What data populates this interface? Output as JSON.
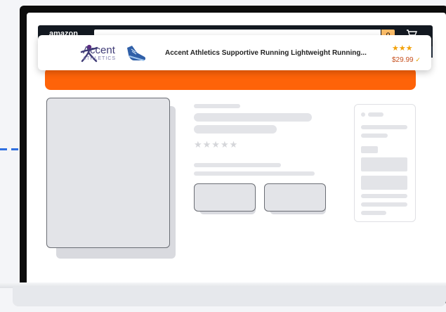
{
  "header": {
    "logo": "amazon",
    "search_icon": "search-icon",
    "cart_icon": "cart-icon",
    "menu_icon": "menu-icon"
  },
  "ad": {
    "brand_name": "Accent",
    "brand_sub": "ATHLETICS",
    "title": "Accent Athletics Supportive Running Lightweight Running...",
    "stars": "★★★",
    "price": "$29.99"
  },
  "colors": {
    "accent_orange": "#fe6309",
    "amazon_dark": "#131921",
    "amazon_search_btn": "#febd69",
    "brand_purple": "#403c77",
    "price_red": "#c7511f",
    "dashed_blue": "#2f6fe0"
  }
}
